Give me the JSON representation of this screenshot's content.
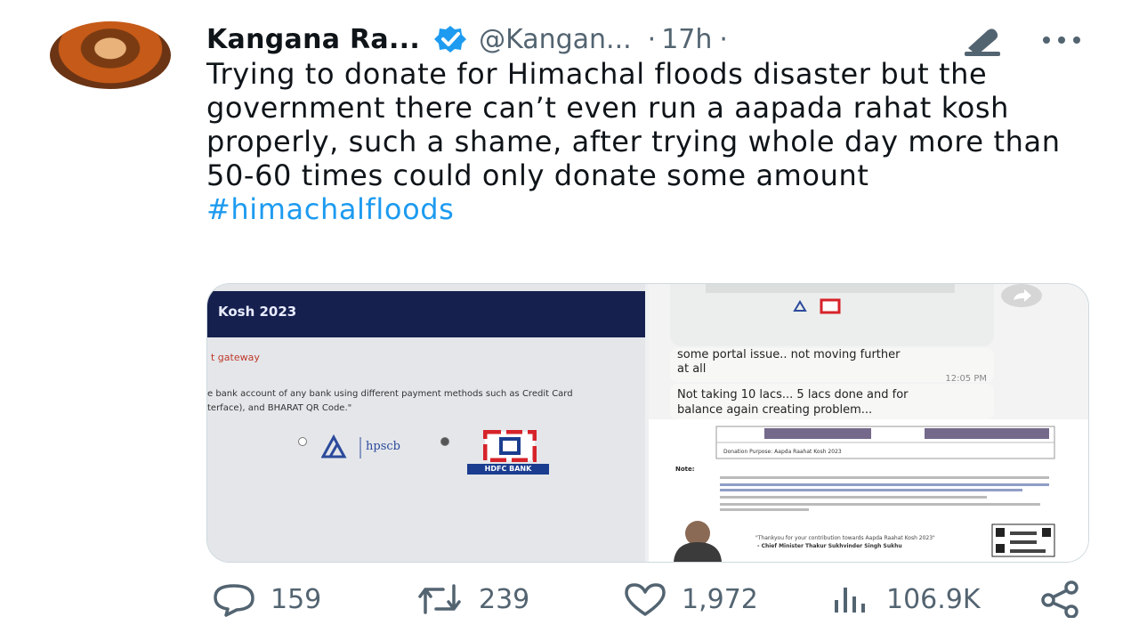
{
  "tweet": {
    "author_name": "Kangana Ra...",
    "handle": "@Kangan...",
    "separator": "·",
    "time": "17h",
    "text": "Trying to donate for Himachal floods disaster but the government there can’t even run a aapada rahat kosh properly, such a shame, after trying whole day more than 50-60 times could only donate some amount",
    "hashtag": "#himachalfloods"
  },
  "media": {
    "left": {
      "banner_title": "Kosh 2023",
      "gateway_label": "t gateway",
      "description_line1": "e bank account of any bank using different payment methods such as Credit Card",
      "description_line2": "terface), and BHARAT QR Code.\"",
      "hpscb_label": "hpscb",
      "hdfc_label": "HDFC BANK"
    },
    "right": {
      "message1_line1": "some portal issue.. not moving further",
      "message1_line2": "at all",
      "message1_time": "12:05 PM",
      "message2_line1": "Not taking 10 lacs... 5 lacs done and for",
      "message2_line2": "balance again creating problem...",
      "receipt_note": "Note:",
      "receipt_purpose": "Donation Purpose: Aapda Raahat Kosh 2023",
      "receipt_quote": "\"Thankyou for your contribution towards Aapda Raahat Kosh 2023\"",
      "receipt_signer": "- Chief Minister Thakur Sukhvinder Singh Sukhu"
    }
  },
  "actions": {
    "replies": "159",
    "reposts": "239",
    "likes": "1,972",
    "views": "106.9K"
  },
  "icons": {
    "verified": "verified-badge-icon",
    "grok": "grok-icon",
    "more": "more-icon",
    "reply": "reply-icon",
    "repost": "repost-icon",
    "like": "like-icon",
    "views": "views-icon",
    "share": "share-icon"
  },
  "colors": {
    "accent": "#1d9bf0",
    "text": "#0f1419",
    "muted": "#536471"
  }
}
